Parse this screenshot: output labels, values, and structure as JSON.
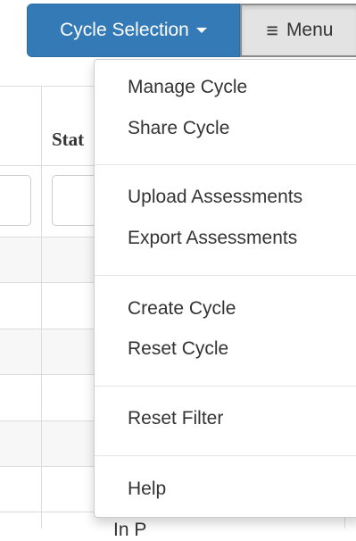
{
  "toolbar": {
    "cycle_selection_label": "Cycle Selection",
    "menu_label": "Menu",
    "menu_icon": "hamburger-icon",
    "caret_icon": "caret-down-icon"
  },
  "table": {
    "partial_header": "Stat",
    "partial_cell": "In P"
  },
  "menu": {
    "groups": [
      [
        "Manage Cycle",
        "Share Cycle"
      ],
      [
        "Upload Assessments",
        "Export Assessments"
      ],
      [
        "Create Cycle",
        "Reset Cycle"
      ],
      [
        "Reset Filter"
      ],
      [
        "Help"
      ]
    ]
  },
  "colors": {
    "primary_button": "#337ab7",
    "menu_button_active": "#e3e3e3",
    "row_stripe": "#f7f7f7"
  }
}
